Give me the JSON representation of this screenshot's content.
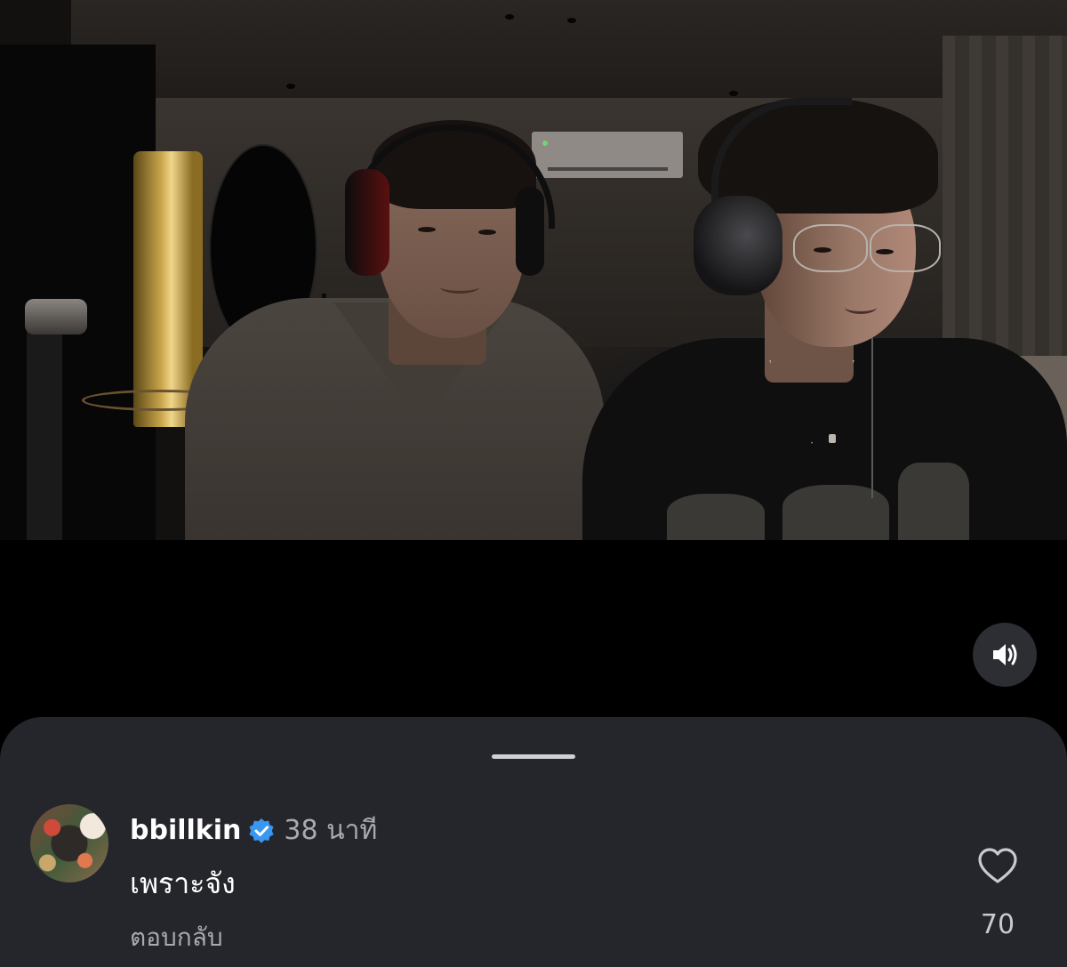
{
  "video": {
    "sound_icon": "speaker-on-icon"
  },
  "comment": {
    "username": "bbillkin",
    "verified_icon": "verified-badge-icon",
    "time": "38 นาที",
    "text": "เพราะจัง",
    "reply_label": "ตอบกลับ",
    "like_icon": "heart-outline-icon",
    "like_count": "70"
  },
  "colors": {
    "background": "#000000",
    "sheet": "#25262b",
    "verified_blue": "#3897f0",
    "muted_text": "#a8aab0"
  }
}
